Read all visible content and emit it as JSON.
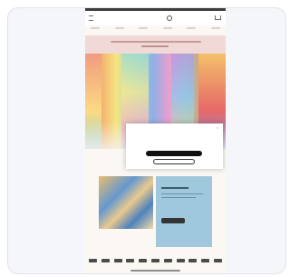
{
  "colors": {
    "card_background": "#f4f6f9",
    "card_border": "#dfe4ea",
    "promo_banner": "#eed3cf",
    "info_card": "#8fbfd8",
    "button_dark": "#111111"
  },
  "icons": [
    "menu-icon",
    "cart-icon",
    "close-icon"
  ],
  "header": {
    "brand": ""
  },
  "popup": {
    "title": "",
    "text_line1": "",
    "text_line2": "",
    "primary_button": "",
    "secondary_button": ""
  }
}
